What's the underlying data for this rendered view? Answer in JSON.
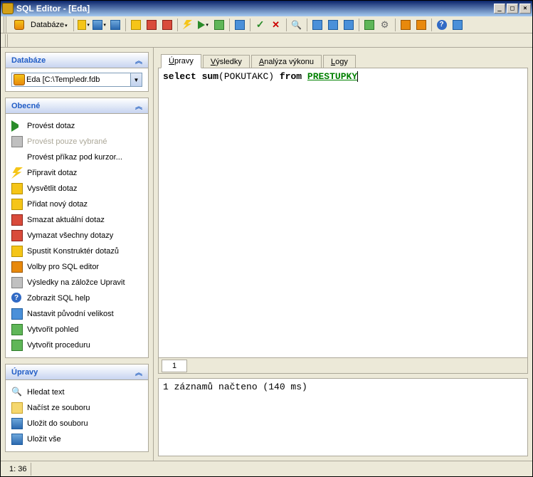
{
  "window": {
    "title": "SQL Editor - [Eda]"
  },
  "wincontrols": {
    "min": "_",
    "max": "□",
    "close": "×"
  },
  "menubar": {
    "database_label": "Databáze"
  },
  "sidebar": {
    "db_panel": {
      "title": "Databáze",
      "selected": "Eda [C:\\Temp\\edr.fdb"
    },
    "obecne_panel": {
      "title": "Obecné",
      "items": [
        {
          "label": "Provést dotaz",
          "icon": "i-run",
          "disabled": false
        },
        {
          "label": "Provést pouze vybrané",
          "icon": "i-gray",
          "disabled": true
        },
        {
          "label": "Provést příkaz pod kurzor...",
          "icon": "",
          "disabled": false
        },
        {
          "label": "Připravit dotaz",
          "icon": "i-bolt",
          "disabled": false
        },
        {
          "label": "Vysvětlit dotaz",
          "icon": "i-yellow",
          "disabled": false
        },
        {
          "label": "Přidat nový dotaz",
          "icon": "i-yellow",
          "disabled": false
        },
        {
          "label": "Smazat aktuální dotaz",
          "icon": "i-red",
          "disabled": false
        },
        {
          "label": "Vymazat všechny dotazy",
          "icon": "i-red",
          "disabled": false
        },
        {
          "label": "Spustit Konstruktér dotazů",
          "icon": "i-yellow",
          "disabled": false
        },
        {
          "label": "Volby pro SQL editor",
          "icon": "i-orange",
          "disabled": false
        },
        {
          "label": "Výsledky na záložce Upravit",
          "icon": "i-gray",
          "disabled": false
        },
        {
          "label": "Zobrazit SQL help",
          "icon": "i-help",
          "disabled": false
        },
        {
          "label": "Nastavit původní velikost",
          "icon": "i-blue",
          "disabled": false
        },
        {
          "label": "Vytvořit pohled",
          "icon": "i-green",
          "disabled": false
        },
        {
          "label": "Vytvořit proceduru",
          "icon": "i-green",
          "disabled": false
        }
      ]
    },
    "upravy_panel": {
      "title": "Úpravy",
      "items": [
        {
          "label": "Hledat text",
          "icon": "i-mag"
        },
        {
          "label": "Načíst ze souboru",
          "icon": "i-folder"
        },
        {
          "label": "Uložit do souboru",
          "icon": "i-disk"
        },
        {
          "label": "Uložit vše",
          "icon": "i-disk"
        }
      ]
    }
  },
  "editor": {
    "tabs": [
      {
        "label": "Úpravy",
        "ul": "Ú",
        "rest": "pravy",
        "active": true
      },
      {
        "label": "Výsledky",
        "ul": "V",
        "rest": "ýsledky",
        "active": false
      },
      {
        "label": "Analýza výkonu",
        "ul": "A",
        "rest": "nalýza výkonu",
        "active": false
      },
      {
        "label": "Logy",
        "ul": "L",
        "rest": "ogy",
        "active": false
      }
    ],
    "sql": {
      "kw1": "select",
      "fn": "sum",
      "arg": "POKUTAKC",
      "kw2": "from",
      "table": "PRESTUPKY"
    },
    "pagetab": "1"
  },
  "messages": {
    "line1": "1 záznamů načteno (140 ms)"
  },
  "status": {
    "pos": "1:  36"
  }
}
